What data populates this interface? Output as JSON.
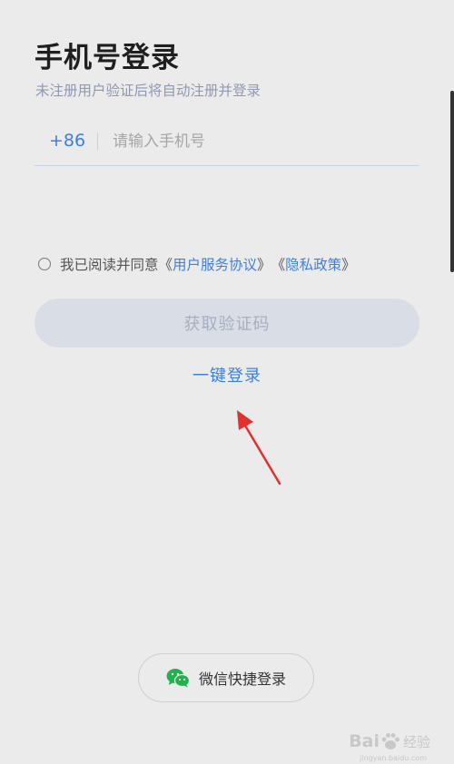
{
  "header": {
    "title": "手机号登录",
    "subtitle": "未注册用户验证后将自动注册并登录"
  },
  "phone": {
    "country_code": "+86",
    "placeholder": "请输入手机号",
    "value": ""
  },
  "agreement": {
    "prefix": "我已阅读并同意",
    "open1": "《",
    "link1": "用户服务协议",
    "close1": "》",
    "open2": "《",
    "link2": "隐私政策",
    "close2": "》",
    "checked": false
  },
  "buttons": {
    "get_code": "获取验证码",
    "one_click": "一键登录",
    "wechat": "微信快捷登录"
  },
  "watermark": {
    "brand": "Bai",
    "suffix": "经验",
    "url": "jingyan.baidu.com"
  },
  "colors": {
    "accent": "#3f7fd9",
    "disabled_button": "#d9dde6",
    "annotation_arrow": "#e03131",
    "wechat_green": "#22b14c"
  }
}
